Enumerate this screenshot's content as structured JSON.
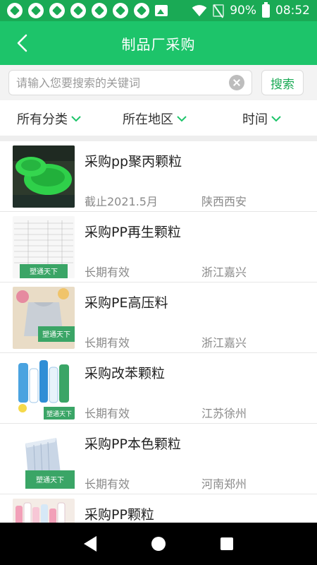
{
  "status_bar": {
    "battery": "90%",
    "time": "08:52",
    "icons": [
      "notification-icon",
      "notification-icon",
      "notification-icon",
      "notification-icon",
      "notification-icon",
      "notification-icon",
      "notification-icon",
      "image-icon",
      "wifi-icon",
      "no-sim-icon",
      "battery-icon"
    ]
  },
  "header": {
    "title": "制品厂采购",
    "back_icon": "chevron-left-icon"
  },
  "search": {
    "placeholder": "请输入您要搜索的关键词",
    "value": "",
    "button_label": "搜索"
  },
  "filters": [
    {
      "label": "所有分类"
    },
    {
      "label": "所在地区"
    },
    {
      "label": "时间"
    }
  ],
  "items": [
    {
      "title": "采购pp聚丙颗粒",
      "term": "截止2021.5月",
      "location": "陕西西安",
      "thumb_caption": ""
    },
    {
      "title": "采购PP再生颗粒",
      "term": "长期有效",
      "location": "浙江嘉兴",
      "thumb_caption": "塑通天下"
    },
    {
      "title": "采购PE高压料",
      "term": "长期有效",
      "location": "浙江嘉兴",
      "thumb_caption": "塑通天下"
    },
    {
      "title": "采购改苯颗粒",
      "term": "长期有效",
      "location": "江苏徐州",
      "thumb_caption": "塑通天下"
    },
    {
      "title": "采购PP本色颗粒",
      "term": "长期有效",
      "location": "河南郑州",
      "thumb_caption": "塑通天下"
    },
    {
      "title": "采购PP颗粒",
      "term": "",
      "location": "",
      "thumb_caption": ""
    }
  ],
  "colors": {
    "accent": "#1dc46a",
    "status_bar": "#1aaa55",
    "text_primary": "#222222",
    "text_secondary": "#8a8a8a"
  }
}
